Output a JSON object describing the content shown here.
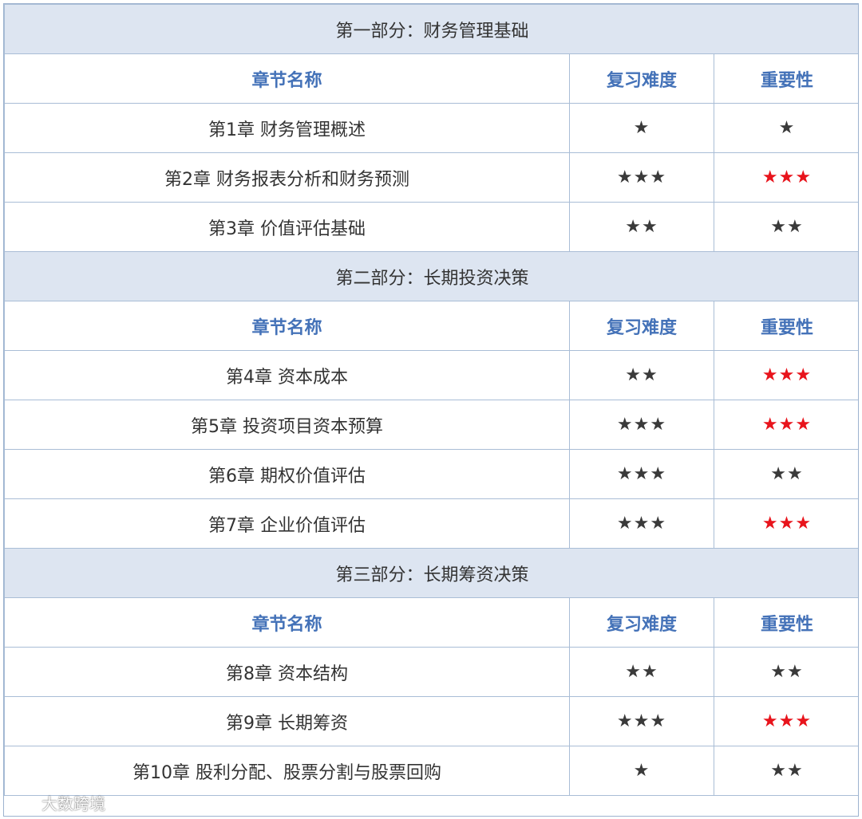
{
  "sections": [
    {
      "title": "第一部分：财务管理基础",
      "headers": [
        "章节名称",
        "复习难度",
        "重要性"
      ],
      "rows": [
        {
          "chapter": "第1章  财务管理概述",
          "difficulty": "★",
          "importance": "★",
          "importance_color": "black"
        },
        {
          "chapter": "第2章  财务报表分析和财务预测",
          "difficulty": "★★★",
          "importance": "★★★",
          "importance_color": "red"
        },
        {
          "chapter": "第3章  价值评估基础",
          "difficulty": "★★",
          "importance": "★★",
          "importance_color": "black"
        }
      ]
    },
    {
      "title": "第二部分：长期投资决策",
      "headers": [
        "章节名称",
        "复习难度",
        "重要性"
      ],
      "rows": [
        {
          "chapter": "第4章  资本成本",
          "difficulty": "★★",
          "importance": "★★★",
          "importance_color": "red"
        },
        {
          "chapter": "第5章  投资项目资本预算",
          "difficulty": "★★★",
          "importance": "★★★",
          "importance_color": "red"
        },
        {
          "chapter": "第6章  期权价值评估",
          "difficulty": "★★★",
          "importance": "★★",
          "importance_color": "black"
        },
        {
          "chapter": "第7章  企业价值评估",
          "difficulty": "★★★",
          "importance": "★★★",
          "importance_color": "red"
        }
      ]
    },
    {
      "title": "第三部分：长期筹资决策",
      "headers": [
        "章节名称",
        "复习难度",
        "重要性"
      ],
      "rows": [
        {
          "chapter": "第8章  资本结构",
          "difficulty": "★★",
          "importance": "★★",
          "importance_color": "black"
        },
        {
          "chapter": "第9章  长期筹资",
          "difficulty": "★★★",
          "importance": "★★★",
          "importance_color": "red"
        },
        {
          "chapter": "第10章  股利分配、股票分割与股票回购",
          "difficulty": "★",
          "importance": "★★",
          "importance_color": "black"
        }
      ]
    }
  ],
  "colors": {
    "header_blue": "#4472b8",
    "section_bg": "#dde5f1",
    "star_red": "#e8141c",
    "star_dark": "#3a3a3a"
  },
  "watermark": {
    "text": "大数跨境",
    "icon": "dashuju-logo-icon"
  }
}
